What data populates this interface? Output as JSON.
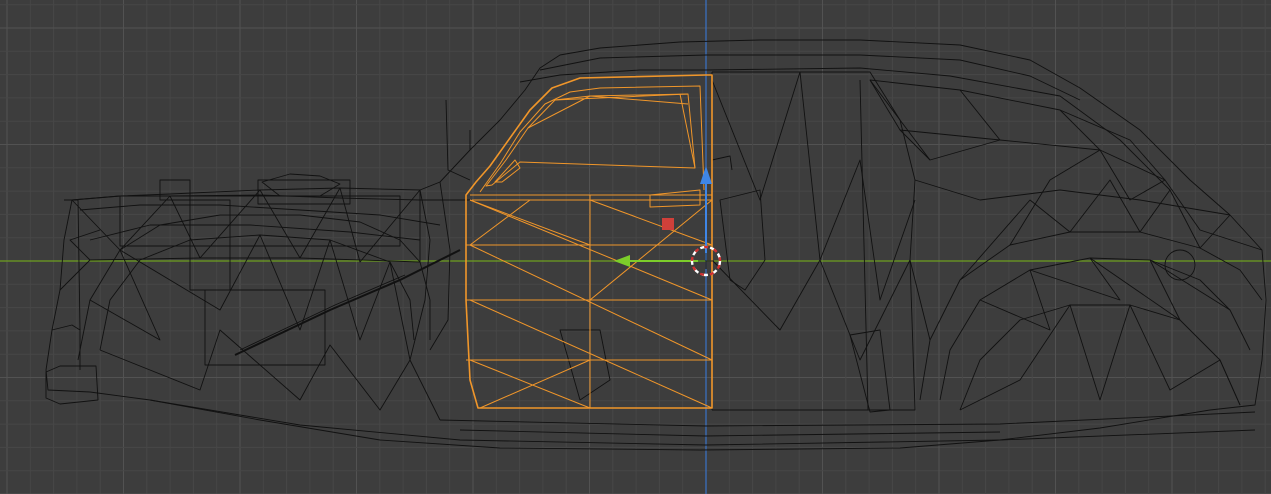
{
  "viewport": {
    "view": "side",
    "shading": "wireframe",
    "selected_object": "door",
    "colors": {
      "background": "#3d3d3d",
      "grid_minor": "#474747",
      "grid_major": "#525252",
      "axis_x": "#6ea020",
      "axis_z": "#3a73c8",
      "wire": "#111111",
      "selection": "#f0962a",
      "gizmo_y": "#7ccd2a",
      "gizmo_z": "#3f86e6",
      "gizmo_x": "#d0403a",
      "cursor": "#ffffff"
    }
  },
  "icons": {
    "cursor": "3d-cursor-icon",
    "gizmo_y": "arrow-left-icon",
    "gizmo_z": "arrow-up-icon",
    "gizmo_x": "square-handle-icon"
  }
}
